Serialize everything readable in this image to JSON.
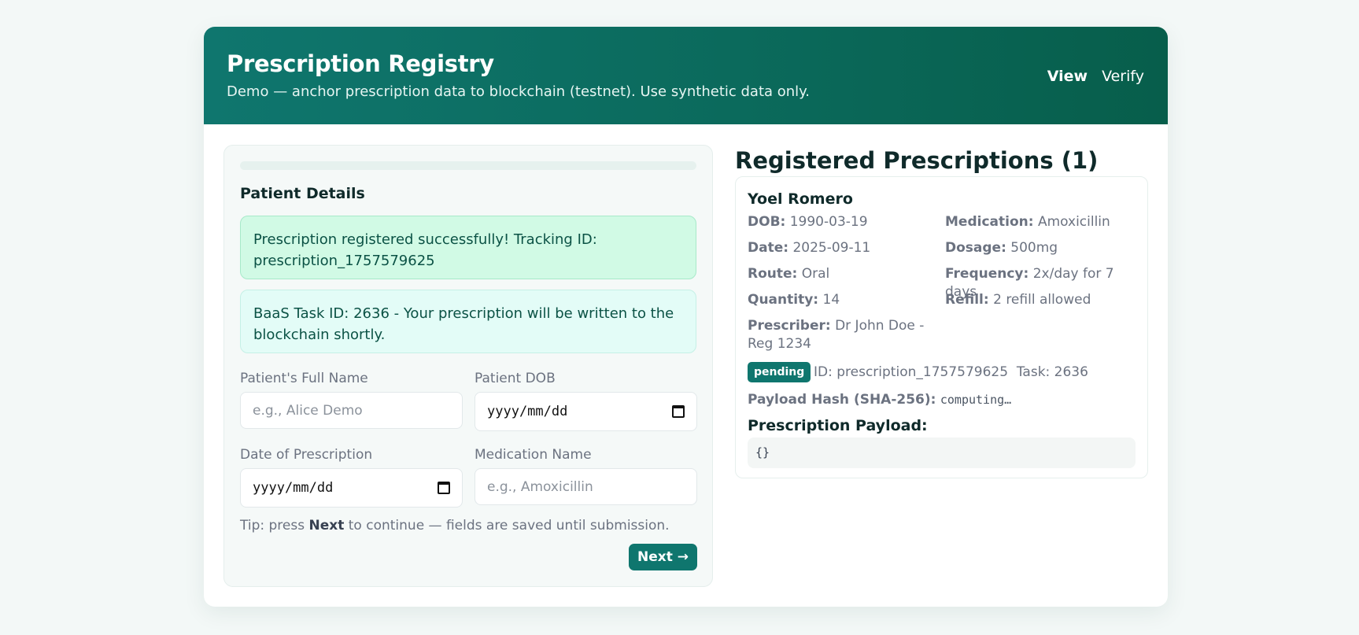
{
  "header": {
    "title": "Prescription Registry",
    "subtitle": "Demo — anchor prescription data to blockchain (testnet). Use synthetic data only.",
    "nav": {
      "view": "View",
      "verify": "Verify"
    }
  },
  "form": {
    "progress_percent": 0,
    "section_title": "Patient Details",
    "success_message": "Prescription registered successfully! Tracking ID: prescription_1757579625",
    "info_message": "BaaS Task ID: 2636 - Your prescription will be written to the blockchain shortly.",
    "fields": {
      "patient_name": {
        "label": "Patient's Full Name",
        "placeholder": "e.g., Alice Demo"
      },
      "patient_dob": {
        "label": "Patient DOB",
        "value": "yyyy/mm/dd"
      },
      "date_of_prescription": {
        "label": "Date of Prescription",
        "value": "yyyy/mm/dd"
      },
      "medication_name": {
        "label": "Medication Name",
        "placeholder": "e.g., Amoxicillin"
      }
    },
    "tip": {
      "prefix": "Tip: press ",
      "bold": "Next",
      "suffix": " to continue — fields are saved until submission."
    },
    "next_button": "Next →"
  },
  "registry": {
    "title": "Registered Prescriptions (1)",
    "item": {
      "name": "Yoel Romero",
      "dob_label": "DOB:",
      "dob": "1990-03-19",
      "medication_label": "Medication:",
      "medication": "Amoxicillin",
      "date_label": "Date:",
      "date": "2025-09-11",
      "dosage_label": "Dosage:",
      "dosage": "500mg",
      "route_label": "Route:",
      "route": "Oral",
      "frequency_label": "Frequency:",
      "frequency": "2x/day for 7 days",
      "quantity_label": "Quantity:",
      "quantity": "14",
      "refill_label": "Refill:",
      "refill": "2 refill allowed",
      "prescriber_label": "Prescriber:",
      "prescriber": "Dr John Doe - Reg 1234",
      "status": "pending",
      "id_text": "ID: prescription_1757579625",
      "task_text": "Task: 2636",
      "hash_label": "Payload Hash (SHA-256):",
      "hash_value": "computing…",
      "payload_title": "Prescription Payload:",
      "payload": "{}"
    }
  }
}
